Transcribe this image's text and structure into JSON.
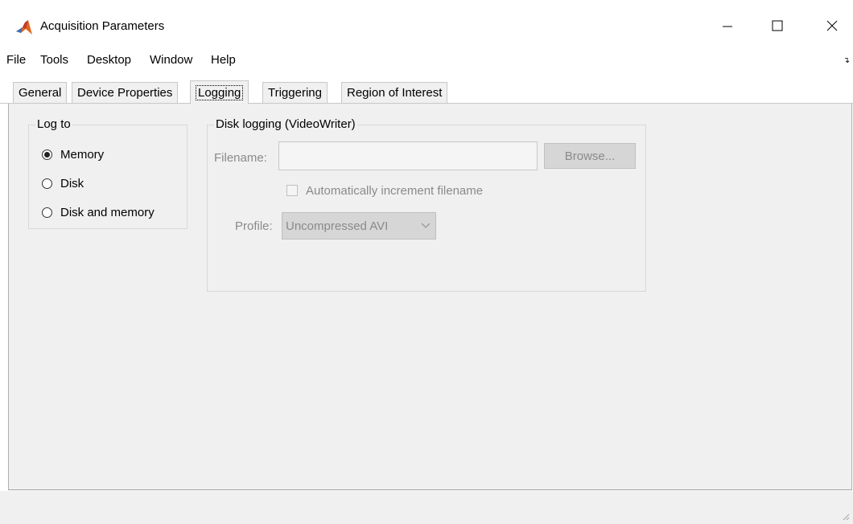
{
  "window": {
    "title": "Acquisition Parameters",
    "minimize_icon": "minimize-icon",
    "maximize_icon": "maximize-icon",
    "close_icon": "close-icon"
  },
  "menu": {
    "items": [
      "File",
      "Tools",
      "Desktop",
      "Window",
      "Help"
    ]
  },
  "tabs": [
    {
      "label": "General",
      "active": false
    },
    {
      "label": "Device Properties",
      "active": false
    },
    {
      "label": "Logging",
      "active": true
    },
    {
      "label": "Triggering",
      "active": false
    },
    {
      "label": "Region of Interest",
      "active": false
    }
  ],
  "log_to": {
    "title": "Log to",
    "options": [
      {
        "label": "Memory",
        "selected": true
      },
      {
        "label": "Disk",
        "selected": false
      },
      {
        "label": "Disk and memory",
        "selected": false
      }
    ]
  },
  "disk_logging": {
    "title": "Disk logging (VideoWriter)",
    "filename_label": "Filename:",
    "filename_value": "",
    "browse_label": "Browse...",
    "auto_increment_label": "Automatically increment filename",
    "auto_increment_checked": false,
    "profile_label": "Profile:",
    "profile_value": "Uncompressed AVI"
  },
  "colors": {
    "panel_bg": "#f0f0f0",
    "disabled_text": "#8a8a8a",
    "matlab_orange": "#e0661f",
    "matlab_red": "#c0392b"
  }
}
